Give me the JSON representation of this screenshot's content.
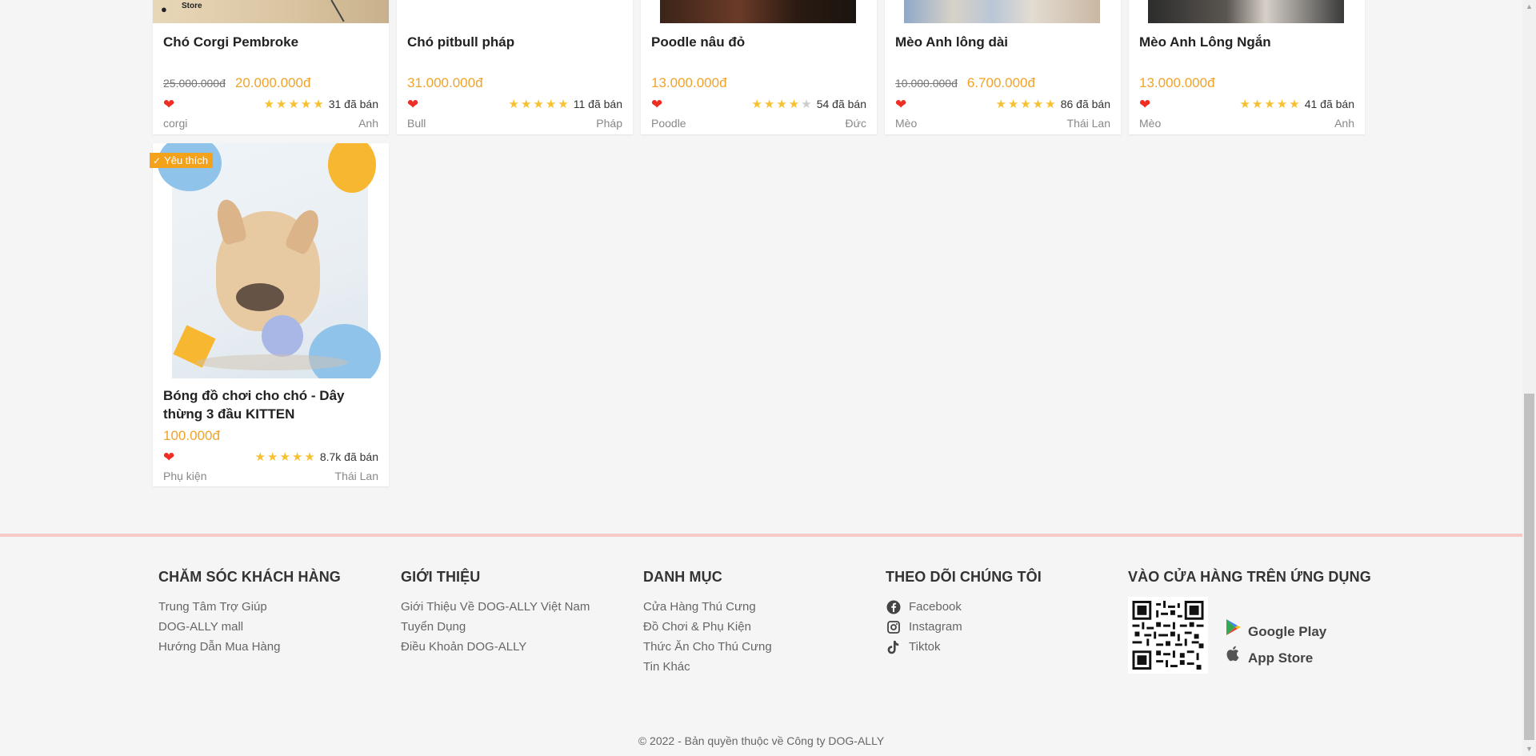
{
  "products_row1": [
    {
      "name": "Chó Corgi Pembroke",
      "old_price": "25.000.000đ",
      "price": "20.000.000đ",
      "rating": 5,
      "sold": "31 đã bán",
      "category": "corgi",
      "origin": "Anh"
    },
    {
      "name": "Chó pitbull pháp",
      "old_price": "",
      "price": "31.000.000đ",
      "rating": 5,
      "sold": "11 đã bán",
      "category": "Bull",
      "origin": "Pháp"
    },
    {
      "name": "Poodle nâu đỏ",
      "old_price": "",
      "price": "13.000.000đ",
      "rating": 4,
      "sold": "54 đã bán",
      "category": "Poodle",
      "origin": "Đức"
    },
    {
      "name": "Mèo Anh lông dài",
      "old_price": "10.000.000đ",
      "price": "6.700.000đ",
      "rating": 5,
      "sold": "86 đã bán",
      "category": "Mèo",
      "origin": "Thái Lan"
    },
    {
      "name": "Mèo Anh Lông Ngắn",
      "old_price": "",
      "price": "13.000.000đ",
      "rating": 5,
      "sold": "41 đã bán",
      "category": "Mèo",
      "origin": "Anh"
    }
  ],
  "product_featured": {
    "badge": "Yêu thích",
    "name": "Bóng đồ chơi cho chó - Dây thừng 3 đầu KITTEN",
    "price": "100.000đ",
    "rating": 5,
    "sold": "8.7k đã bán",
    "category": "Phụ kiện",
    "origin": "Thái Lan"
  },
  "first_card_logo": "Store",
  "footer": {
    "col1": {
      "title": "CHĂM SÓC KHÁCH HÀNG",
      "links": [
        "Trung Tâm Trợ Giúp",
        "DOG-ALLY mall",
        "Hướng Dẫn Mua Hàng"
      ]
    },
    "col2": {
      "title": "GIỚI THIỆU",
      "links": [
        "Giới Thiệu Về DOG-ALLY Việt Nam",
        "Tuyển Dụng",
        "Điều Khoản DOG-ALLY"
      ]
    },
    "col3": {
      "title": "DANH MỤC",
      "links": [
        "Cửa Hàng Thú Cưng",
        "Đồ Chơi & Phụ Kiện",
        "Thức Ăn Cho Thú Cưng",
        "Tin Khác"
      ]
    },
    "col4": {
      "title": "THEO DÕI CHÚNG TÔI",
      "links": [
        "Facebook",
        "Instagram",
        "Tiktok"
      ]
    },
    "col5": {
      "title": "VÀO CỬA HÀNG TRÊN ỨNG DỤNG",
      "apps": [
        "Google Play",
        "App Store"
      ]
    },
    "copyright": "© 2022 - Bản quyền thuộc về Công ty DOG-ALLY"
  },
  "colors": {
    "price": "#f0a32a",
    "heart": "#ee2e24",
    "star": "#f7c02f",
    "badge": "#f4a21a",
    "footer_border": "#f7c9c7"
  }
}
